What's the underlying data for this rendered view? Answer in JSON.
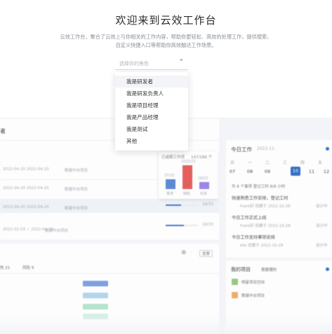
{
  "hero": {
    "title": "欢迎来到云效工作台",
    "desc_line1": "云效工作台，聚合了云效上与你相关的工作内容，帮助你更轻松、高效的处理工作，提供搜索、",
    "desc_line2": "自定义快捷入口等帮助你高效触达工作场景。",
    "select_placeholder": "选择你的角色"
  },
  "role_options": [
    {
      "label": "我是研发者"
    },
    {
      "label": "我是研发负责人"
    },
    {
      "label": "我是项目经理"
    },
    {
      "label": "我是产品经理"
    },
    {
      "label": "我是测试"
    },
    {
      "label": "其他"
    }
  ],
  "left": {
    "header_fragment": "者",
    "rows": [
      {
        "date": "2022-04-20  2022-04-20",
        "name": "数据中台项目"
      },
      {
        "date": "2022-04-20  2022-04-20",
        "name": "数据中台项目"
      },
      {
        "date": "2022-04-20  2022-04-20",
        "name": "数据中台项目",
        "progress_label": "18/33"
      },
      {
        "date": "2022-02-03 ~ 2022-04-20",
        "name": "数据中台项目",
        "progress_label": "18/33"
      }
    ],
    "bottom_filter_a": "色  21",
    "bottom_filter_b": "风险  9",
    "bottom_btn": "全部"
  },
  "mini_chart": {
    "header_a": "已逾期工作项",
    "header_b": "147/186 个",
    "bars": [
      {
        "top_label": "37/33",
        "cat": "需求",
        "color": "#4a7bd0",
        "value": 0.35
      },
      {
        "top_label": "102/122",
        "cat": "缺陷",
        "color": "#e14b48",
        "value": 0.85
      },
      {
        "top_label": "18/32",
        "cat": "任务",
        "color": "#8c7ae6",
        "value": 0.25
      }
    ]
  },
  "today": {
    "title": "今日工作",
    "date": "2022-11",
    "weekdays": [
      "日",
      "一",
      "二",
      "三",
      "四",
      "五"
    ],
    "days": [
      "07",
      "08",
      "09",
      "10",
      "11",
      "12"
    ],
    "summary": "共 8 个事项  登记工时 8/8 小时",
    "items": [
      {
        "title": "快速熟悉工作安排，登记工时",
        "meta": "frank好  创建于 2022-10-28",
        "status": "设计中"
      },
      {
        "title": "今日工作正式上线",
        "meta": "frank好  创建于 2022-10-28",
        "status": "设计中"
      },
      {
        "title": "今日工作支持事项安排",
        "meta": "kkk  创建于 2022-10-28",
        "status": "设计中"
      }
    ]
  },
  "my_projects": {
    "title": "我的项目",
    "filter": "我管理的",
    "items": [
      {
        "name": "明星项目空间"
      },
      {
        "name": "数据中台项目"
      }
    ]
  },
  "colors": {
    "accent": "#1e5fbf",
    "progress": "#2f67c9"
  }
}
